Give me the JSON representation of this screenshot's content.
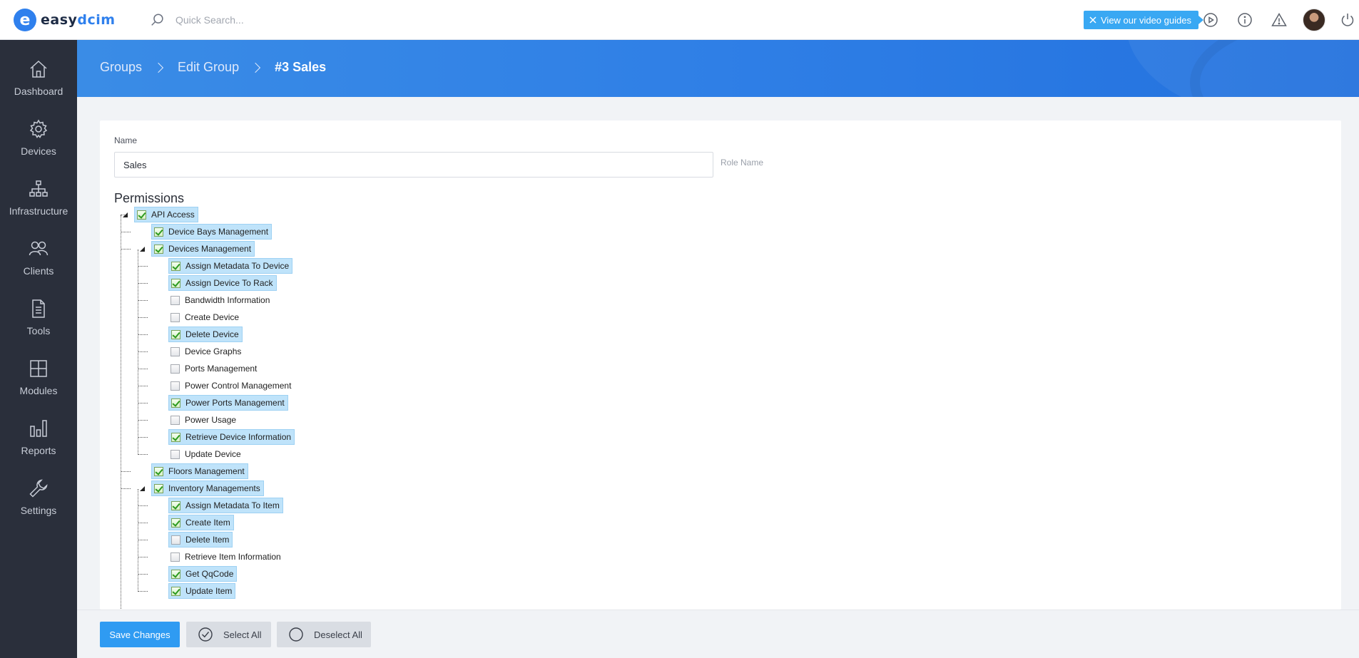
{
  "app": {
    "logo_letter": "e",
    "logo_prefix": "easy",
    "logo_accent": "dcim"
  },
  "search": {
    "placeholder": "Quick Search..."
  },
  "topbar": {
    "video_label": "View our video guides"
  },
  "sidebar": {
    "items": [
      {
        "label": "Dashboard",
        "icon": "home-icon"
      },
      {
        "label": "Devices",
        "icon": "gear-icon"
      },
      {
        "label": "Infrastructure",
        "icon": "sitemap-icon"
      },
      {
        "label": "Clients",
        "icon": "users-icon"
      },
      {
        "label": "Tools",
        "icon": "document-icon"
      },
      {
        "label": "Modules",
        "icon": "grid-icon"
      },
      {
        "label": "Reports",
        "icon": "bar-chart-icon"
      },
      {
        "label": "Settings",
        "icon": "wrench-icon"
      }
    ]
  },
  "breadcrumb": {
    "items": [
      "Groups",
      "Edit Group"
    ],
    "current": "#3 Sales"
  },
  "form": {
    "name_label": "Name",
    "name_value": "Sales",
    "helper": "Role Name",
    "permissions_title": "Permissions"
  },
  "tree": [
    {
      "label": "API Access",
      "level": 0,
      "checked": true,
      "expander": true
    },
    {
      "label": "Device Bays Management",
      "level": 1,
      "checked": true
    },
    {
      "label": "Devices Management",
      "level": 1,
      "checked": true,
      "expander": true
    },
    {
      "label": "Assign Metadata To Device",
      "level": 2,
      "checked": true
    },
    {
      "label": "Assign Device To Rack",
      "level": 2,
      "checked": true
    },
    {
      "label": "Bandwidth Information",
      "level": 2,
      "checked": false
    },
    {
      "label": "Create Device",
      "level": 2,
      "checked": false
    },
    {
      "label": "Delete Device",
      "level": 2,
      "checked": true
    },
    {
      "label": "Device Graphs",
      "level": 2,
      "checked": false
    },
    {
      "label": "Ports Management",
      "level": 2,
      "checked": false
    },
    {
      "label": "Power Control Management",
      "level": 2,
      "checked": false
    },
    {
      "label": "Power Ports Management",
      "level": 2,
      "checked": true
    },
    {
      "label": "Power Usage",
      "level": 2,
      "checked": false
    },
    {
      "label": "Retrieve Device Information",
      "level": 2,
      "checked": true
    },
    {
      "label": "Update Device",
      "level": 2,
      "checked": false
    },
    {
      "label": "Floors Management",
      "level": 1,
      "checked": true
    },
    {
      "label": "Inventory Managements",
      "level": 1,
      "checked": true,
      "expander": true
    },
    {
      "label": "Assign Metadata To Item",
      "level": 2,
      "checked": true
    },
    {
      "label": "Create Item",
      "level": 2,
      "checked": true
    },
    {
      "label": "Delete Item",
      "level": 2,
      "checked": false,
      "highlight": true
    },
    {
      "label": "Retrieve Item Information",
      "level": 2,
      "checked": false
    },
    {
      "label": "Get QqCode",
      "level": 2,
      "checked": true
    },
    {
      "label": "Update Item",
      "level": 2,
      "checked": true
    }
  ],
  "footer": {
    "save_label": "Save Changes",
    "select_all_label": "Select All",
    "deselect_all_label": "Deselect All"
  },
  "colors": {
    "accent": "#2f80ed",
    "sidebar_bg": "#2a2f3b",
    "selected_bg": "#bfe3fa",
    "video_button": "#39a8f3",
    "save_button": "#2f9bf2"
  }
}
